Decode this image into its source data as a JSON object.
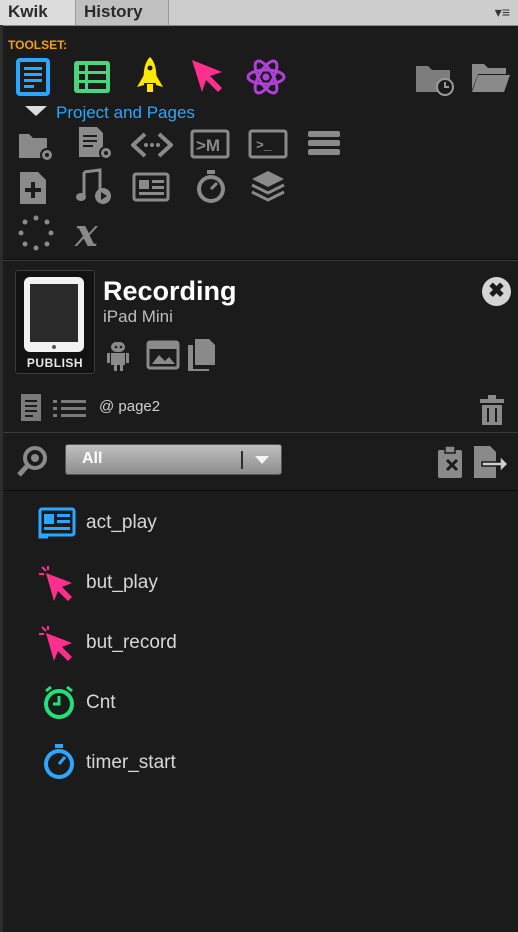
{
  "tabs": [
    {
      "label": "Kwik",
      "active": true
    },
    {
      "label": "History",
      "active": false
    }
  ],
  "panel_menu_glyph": "▾≡",
  "toolset": {
    "label": "TOOLSET:",
    "tools": [
      {
        "icon": "project-document-icon",
        "color": "#2aa7ff"
      },
      {
        "icon": "list-grid-icon",
        "color": "#4cd47a"
      },
      {
        "icon": "rocket-icon",
        "color": "#ffe800"
      },
      {
        "icon": "pointer-cursor-icon",
        "color": "#ff2f8e"
      },
      {
        "icon": "atom-icon",
        "color": "#b040d8"
      }
    ],
    "right_tools": [
      "folder-clock-icon",
      "open-folder-icon"
    ]
  },
  "section": {
    "title": "Project and Pages",
    "icons_row1": [
      "folder-settings-icon",
      "page-settings-icon",
      "code-tags-icon",
      "html-icon",
      "terminal-icon",
      "database-icon"
    ],
    "icons_row2": [
      "add-page-icon",
      "audio-video-icon",
      "article-icon",
      "stopwatch-icon",
      "layers-icon"
    ],
    "icons_row3": [
      "spinner-icon",
      "variable-x-icon"
    ]
  },
  "publish": {
    "title": "Recording",
    "device": "iPad Mini",
    "publish_label": "PUBLISH",
    "close_glyph": "✖",
    "action_icons": [
      "android-icon",
      "image-gallery-icon",
      "copy-pages-icon"
    ]
  },
  "page": {
    "label": "@ page2",
    "icons": [
      "page-icon",
      "list-icon"
    ],
    "trash_icon": "trash-icon"
  },
  "filter": {
    "selected": "All",
    "search_icon": "search-icon",
    "right_icons": [
      "clipboard-icon",
      "export-icon"
    ]
  },
  "layers": [
    {
      "name": "act_play",
      "icon": "action-icon",
      "color": "#2aa7ff"
    },
    {
      "name": "but_play",
      "icon": "button-cursor-icon",
      "color": "#ff2f8e"
    },
    {
      "name": "but_record",
      "icon": "button-cursor-icon",
      "color": "#ff2f8e"
    },
    {
      "name": "Cnt",
      "icon": "counter-clock-icon",
      "color": "#24e07a"
    },
    {
      "name": "timer_start",
      "icon": "timer-icon",
      "color": "#2aa7ff"
    }
  ]
}
